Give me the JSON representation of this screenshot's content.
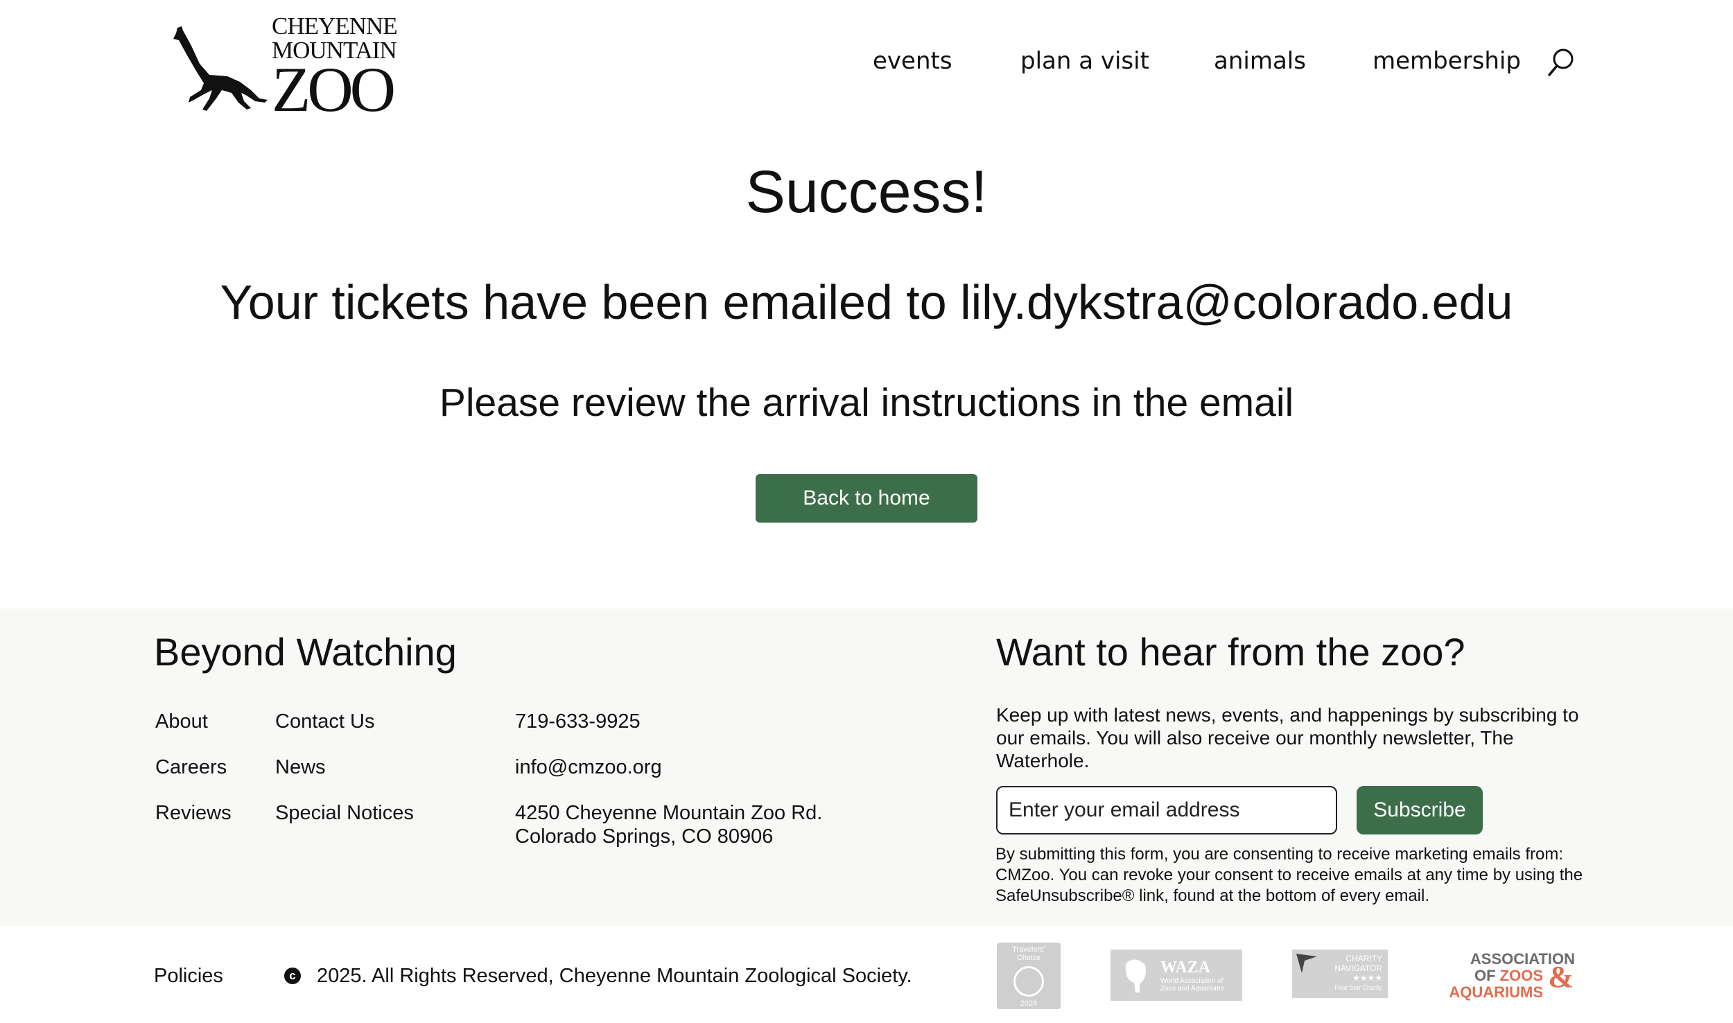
{
  "header": {
    "logo": {
      "line1": "CHEYENNE",
      "line2": "MOUNTAIN",
      "line3": "ZOO"
    },
    "nav": [
      {
        "label": "events"
      },
      {
        "label": "plan a visit"
      },
      {
        "label": "animals"
      },
      {
        "label": "membership"
      }
    ]
  },
  "main": {
    "title": "Success!",
    "tickets_message": "Your tickets have been emailed to lily.dykstra@colorado.edu",
    "review_message": "Please review the arrival instructions in the email",
    "back_button": "Back to home"
  },
  "footer": {
    "heading": "Beyond Watching",
    "links_col1": [
      "About",
      "Careers",
      "Reviews"
    ],
    "links_col2": [
      "Contact Us",
      "News",
      "Special Notices"
    ],
    "phone": "719-633-9925",
    "email": "info@cmzoo.org",
    "address_line1": "4250 Cheyenne Mountain Zoo Rd.",
    "address_line2": "Colorado Springs, CO 80906",
    "newsletter": {
      "heading": "Want to hear from the zoo?",
      "text": "Keep up with latest news, events, and happenings by subscribing to our emails. You will also receive our monthly newsletter, The Waterhole.",
      "input_placeholder": "Enter your email address",
      "subscribe_label": "Subscribe",
      "consent": "By submitting this form, you are consenting to receive marketing emails from: CMZoo. You can revoke your consent to receive emails at any time by using the SafeUnsubscribe® link, found at the bottom of every email."
    }
  },
  "bottom": {
    "policies": "Policies",
    "copyright_symbol": "c",
    "copyright": "2025. All Rights Reserved, Cheyenne Mountain Zoological Society.",
    "badges": {
      "tripadvisor": {
        "line1": "Travelers'",
        "line2": "Choice",
        "year": "2024"
      },
      "waza": {
        "title": "WAZA",
        "subtitle": "World Association of Zoos and Aquariums"
      },
      "charity": {
        "line1": "CHARITY",
        "line2": "NAVIGATOR",
        "stars": "★★★★",
        "line3": "Four Star Charity"
      },
      "aza": {
        "line1": "ASSOCIATION",
        "line2a": "OF ",
        "line2b": "ZOOS",
        "line3": "AQUARIUMS",
        "amp": "&"
      }
    }
  },
  "colors": {
    "accent_green": "#3d6e4a",
    "footer_bg": "#f8f8f6",
    "aza_orange": "#e36b4f"
  }
}
